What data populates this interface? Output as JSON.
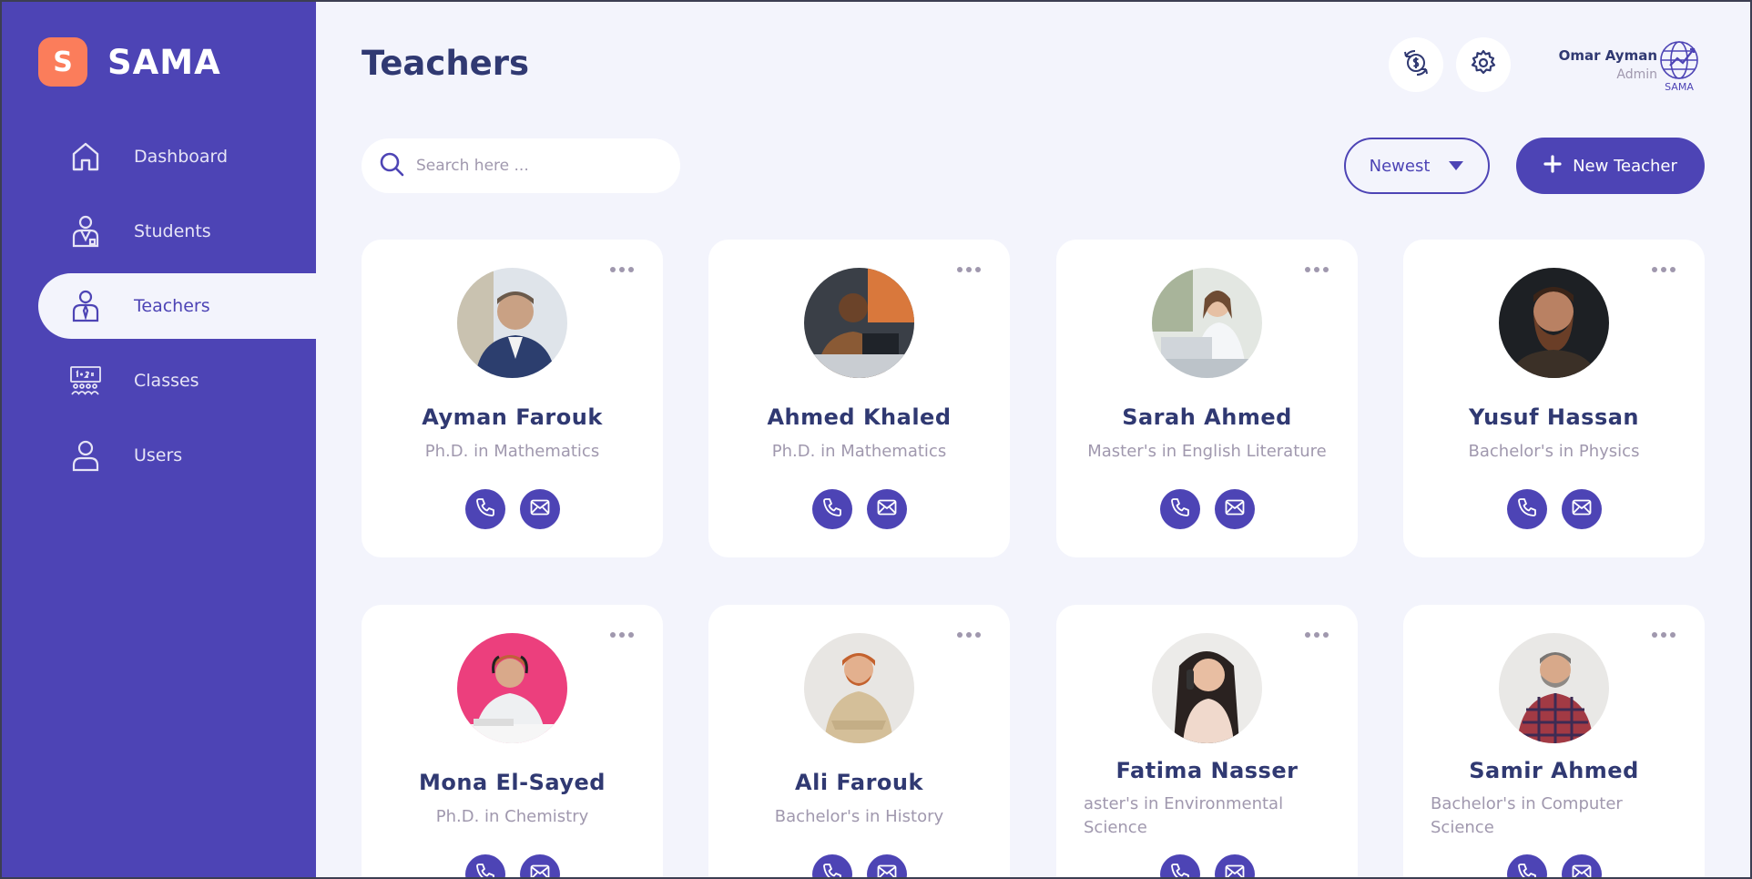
{
  "brand": {
    "logo_letter": "S",
    "name": "SAMA"
  },
  "sidebar": {
    "items": [
      {
        "label": "Dashboard",
        "icon": "home-icon",
        "active": false
      },
      {
        "label": "Students",
        "icon": "student-icon",
        "active": false
      },
      {
        "label": "Teachers",
        "icon": "teacher-icon",
        "active": true
      },
      {
        "label": "Classes",
        "icon": "classroom-icon",
        "active": false
      },
      {
        "label": "Users",
        "icon": "user-icon",
        "active": false
      }
    ]
  },
  "header": {
    "title": "Teachers",
    "user_name": "Omar Ayman",
    "user_role": "Admin",
    "logo_text": "SAMA"
  },
  "toolbar": {
    "search_placeholder": "Search here ...",
    "sort_label": "Newest",
    "new_button_label": "New Teacher"
  },
  "teachers": [
    {
      "name": "Ayman Farouk",
      "degree": "Ph.D. in Mathematics"
    },
    {
      "name": "Ahmed Khaled",
      "degree": "Ph.D. in Mathematics"
    },
    {
      "name": "Sarah Ahmed",
      "degree": "Master's in English Literature"
    },
    {
      "name": "Yusuf Hassan",
      "degree": "Bachelor's in Physics"
    },
    {
      "name": "Mona El-Sayed",
      "degree": "Ph.D. in Chemistry"
    },
    {
      "name": "Ali Farouk",
      "degree": "Bachelor's in History"
    },
    {
      "name": "Fatima Nasser",
      "degree": "aster's in Environmental Science"
    },
    {
      "name": "Samir Ahmed",
      "degree": "Bachelor's in Computer Science"
    }
  ],
  "colors": {
    "primary": "#4D44B5",
    "accent": "#FB7D5B",
    "background": "#F3F4FC",
    "text_dark": "#303972",
    "text_muted": "#A098AE"
  }
}
